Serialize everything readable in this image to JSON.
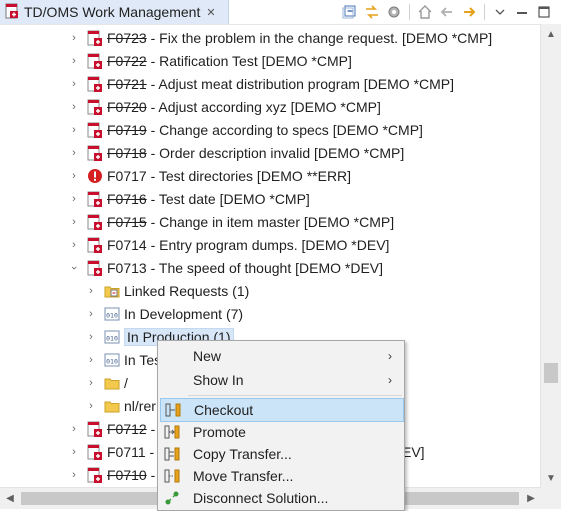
{
  "window": {
    "title": "TD/OMS Work Management",
    "close_glyph": "✕"
  },
  "toolbar": {
    "icons": [
      "collapse-all-icon",
      "link-with-editor-icon",
      "settings-icon",
      "home-icon",
      "back-icon",
      "forward-icon",
      "view-menu-icon",
      "minimize-icon",
      "maximize-icon"
    ]
  },
  "tree": {
    "rows": [
      {
        "label": "F0723 - Fix the problem in the change request. [DEMO *CMP]",
        "id": "F0723",
        "rest": " - Fix the problem in the change request. [DEMO *CMP]",
        "icon": "completed-request-icon"
      },
      {
        "label": "F0722 - Ratification Test [DEMO *CMP]",
        "id": "F0722",
        "rest": " - Ratification Test [DEMO *CMP]",
        "icon": "completed-request-icon"
      },
      {
        "label": "F0721 - Adjust meat distribution program [DEMO *CMP]",
        "id": "F0721",
        "rest": " - Adjust meat distribution program [DEMO *CMP]",
        "icon": "completed-request-icon"
      },
      {
        "label": "F0720 - Adjust according xyz [DEMO *CMP]",
        "id": "F0720",
        "rest": " - Adjust according xyz [DEMO *CMP]",
        "icon": "completed-request-icon"
      },
      {
        "label": "F0719 - Change according to specs [DEMO *CMP]",
        "id": "F0719",
        "rest": " - Change according to specs [DEMO *CMP]",
        "icon": "completed-request-icon"
      },
      {
        "label": "F0718 - Order description invalid [DEMO *CMP]",
        "id": "F0718",
        "rest": " - Order description invalid [DEMO *CMP]",
        "icon": "completed-request-icon"
      },
      {
        "label": "F0717 - Test directories [DEMO **ERR]",
        "id": "F0717",
        "rest": " - Test directories [DEMO **ERR]",
        "icon": "error-request-icon"
      },
      {
        "label": "F0716 - Test date [DEMO *CMP]",
        "id": "F0716",
        "rest": " - Test date [DEMO *CMP]",
        "icon": "completed-request-icon"
      },
      {
        "label": "F0715 - Change in item master [DEMO *CMP]",
        "id": "F0715",
        "rest": " - Change in item master [DEMO *CMP]",
        "icon": "completed-request-icon"
      },
      {
        "label": "F0714 - Entry program dumps. [DEMO *DEV]",
        "id": "F0714",
        "rest": " - Entry program dumps. [DEMO *DEV]",
        "icon": "request-icon"
      },
      {
        "label": "F0713 - The speed of thought [DEMO *DEV]",
        "id": "F0713",
        "rest": " - The speed of thought [DEMO *DEV]",
        "icon": "request-icon"
      },
      {
        "label": "Linked Requests (1)",
        "icon": "linked-requests-folder-icon"
      },
      {
        "label": "In Development (7)",
        "icon": "binary-environment-icon"
      },
      {
        "label": "In Production (1)",
        "icon": "binary-environment-icon"
      },
      {
        "label": "In Tes",
        "icon": "binary-environment-icon"
      },
      {
        "label": "/",
        "icon": "folder-icon"
      },
      {
        "label": "nl/rer",
        "icon": "folder-icon"
      },
      {
        "label": "F0712 -",
        "id": "F0712",
        "rest": " -",
        "icon": "completed-request-icon"
      },
      {
        "label": "F0711 -",
        "id": "F0711",
        "rest": " -",
        "icon": "request-icon",
        "tail": "EV]"
      },
      {
        "label": "F0710 -",
        "id": "F0710",
        "rest": " -",
        "icon": "completed-request-icon"
      }
    ]
  },
  "context_menu": {
    "items": [
      {
        "label": "New",
        "submenu": true,
        "icon": ""
      },
      {
        "label": "Show In",
        "submenu": true,
        "icon": ""
      },
      {
        "label": "Checkout",
        "icon": "checkout-icon",
        "highlighted": true
      },
      {
        "label": "Promote",
        "icon": "promote-icon"
      },
      {
        "label": "Copy Transfer...",
        "icon": "copy-transfer-icon"
      },
      {
        "label": "Move Transfer...",
        "icon": "move-transfer-icon"
      },
      {
        "label": "Disconnect Solution...",
        "icon": "disconnect-solution-icon"
      }
    ],
    "submenu_glyph": "›"
  },
  "colors": {
    "selection": "#d8e7f8",
    "menu_highlight": "#cce4f7",
    "error": "#d42020",
    "request_red": "#c8102e"
  }
}
